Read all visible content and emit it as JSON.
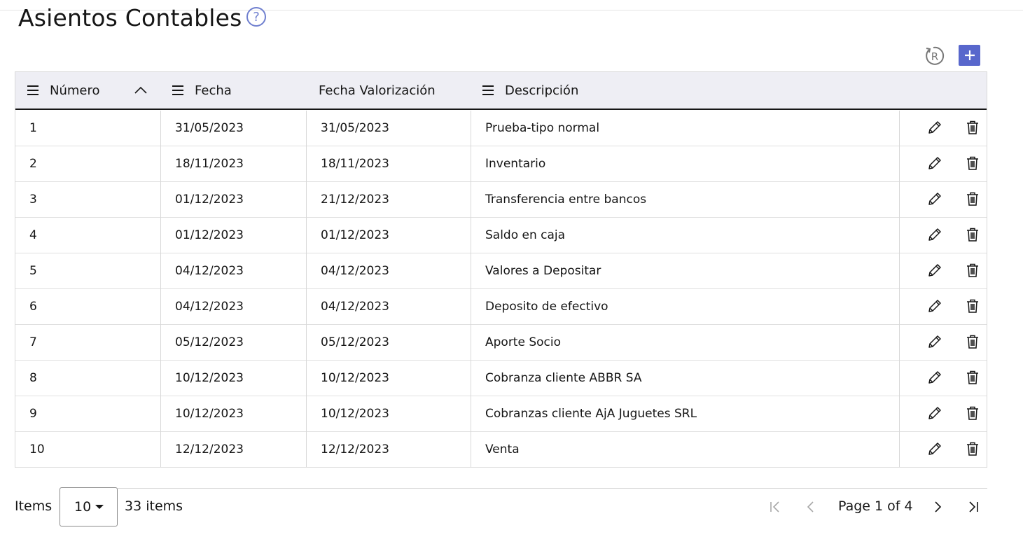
{
  "page": {
    "title": "Asientos Contables",
    "help_icon": "question-circle-icon",
    "reset_icon": "reset-r-icon",
    "add_icon": "plus-icon",
    "accent_color": "#5867cc"
  },
  "table": {
    "columns": [
      "Número",
      "Fecha",
      "Fecha Valorización",
      "Descripción"
    ],
    "sort_column": "Número",
    "sort_direction": "ascending",
    "rows": [
      {
        "numero": "1",
        "fecha": "31/05/2023",
        "fecha_valorizacion": "31/05/2023",
        "descripcion": "Prueba-tipo normal"
      },
      {
        "numero": "2",
        "fecha": "18/11/2023",
        "fecha_valorizacion": "18/11/2023",
        "descripcion": "Inventario"
      },
      {
        "numero": "3",
        "fecha": "01/12/2023",
        "fecha_valorizacion": "21/12/2023",
        "descripcion": "Transferencia entre bancos"
      },
      {
        "numero": "4",
        "fecha": "01/12/2023",
        "fecha_valorizacion": "01/12/2023",
        "descripcion": "Saldo en caja"
      },
      {
        "numero": "5",
        "fecha": "04/12/2023",
        "fecha_valorizacion": "04/12/2023",
        "descripcion": "Valores a Depositar"
      },
      {
        "numero": "6",
        "fecha": "04/12/2023",
        "fecha_valorizacion": "04/12/2023",
        "descripcion": "Deposito de efectivo"
      },
      {
        "numero": "7",
        "fecha": "05/12/2023",
        "fecha_valorizacion": "05/12/2023",
        "descripcion": "Aporte Socio"
      },
      {
        "numero": "8",
        "fecha": "10/12/2023",
        "fecha_valorizacion": "10/12/2023",
        "descripcion": "Cobranza cliente ABBR SA"
      },
      {
        "numero": "9",
        "fecha": "10/12/2023",
        "fecha_valorizacion": "10/12/2023",
        "descripcion": "Cobranzas cliente AjA Juguetes SRL"
      },
      {
        "numero": "10",
        "fecha": "12/12/2023",
        "fecha_valorizacion": "12/12/2023",
        "descripcion": "Venta"
      }
    ],
    "row_actions": [
      "pencil-icon",
      "trash-icon"
    ]
  },
  "pagination": {
    "items_label": "Items",
    "page_size": "10",
    "total_label": "33 items",
    "page_label": "Page 1 of 4"
  }
}
